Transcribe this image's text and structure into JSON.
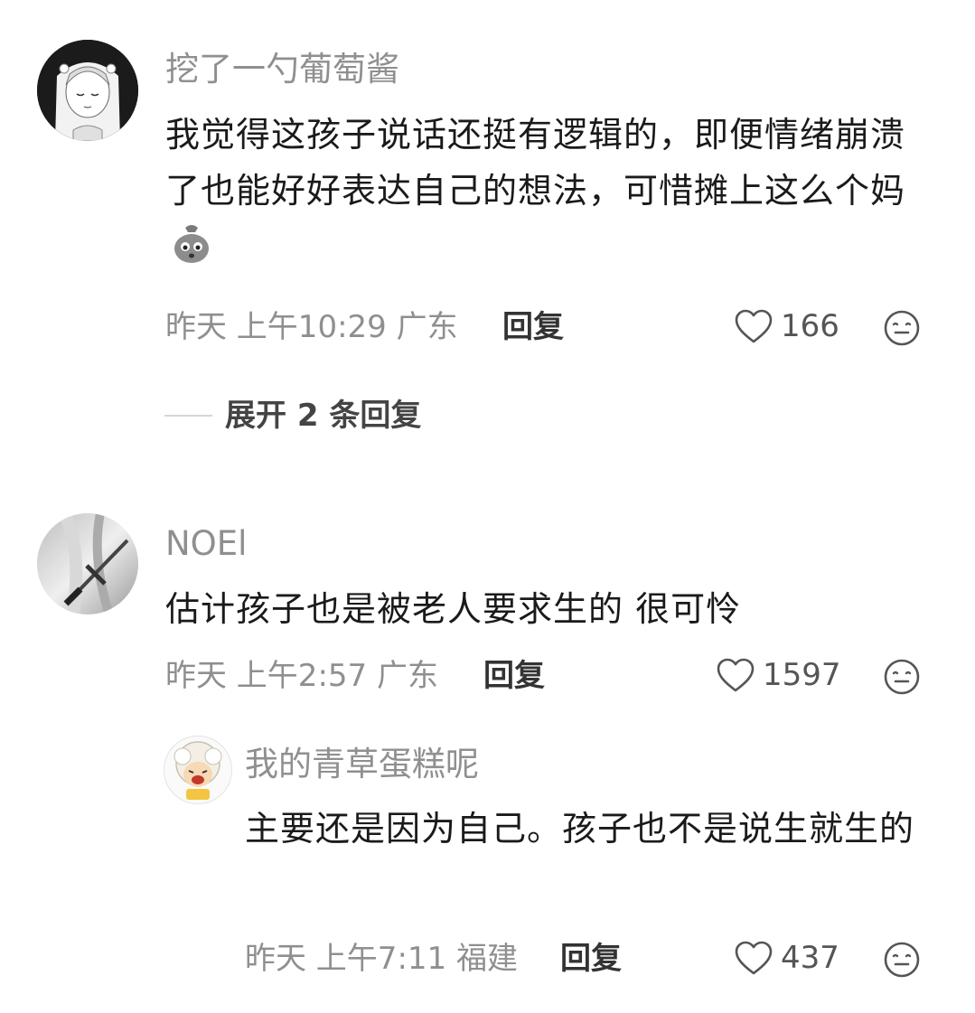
{
  "comments": [
    {
      "username": "挖了一勺葡萄酱",
      "content": "我觉得这孩子说话还挺有逻辑的，即便情绪崩溃了也能好好表达自己的想法，可惜摊上这么个妈",
      "time": "昨天 上午10:29",
      "location": "广东",
      "reply_label": "回复",
      "likes": "166",
      "avatar_icon": "anime-girl-avatar",
      "inline_emoji_icon": "sack-face-emoji",
      "expand_replies": "展开 2 条回复"
    },
    {
      "username": "NOEl",
      "content": "估计孩子也是被老人要求生的 很可怜",
      "time": "昨天 上午2:57",
      "location": "广东",
      "reply_label": "回复",
      "likes": "1597",
      "avatar_icon": "sword-avatar"
    }
  ],
  "replies": [
    {
      "username": "我的青草蛋糕呢",
      "content": "主要还是因为自己。孩子也不是说生就生的",
      "time": "昨天 上午7:11",
      "location": "福建",
      "reply_label": "回复",
      "likes": "437",
      "avatar_icon": "crying-sheep-avatar"
    }
  ],
  "icons": {
    "like": "heart-outline-icon",
    "emoji": "emoji-face-icon"
  },
  "colors": {
    "username": "#8f8f8f",
    "content": "#1a1a1a",
    "meta": "#8f8f8f"
  }
}
